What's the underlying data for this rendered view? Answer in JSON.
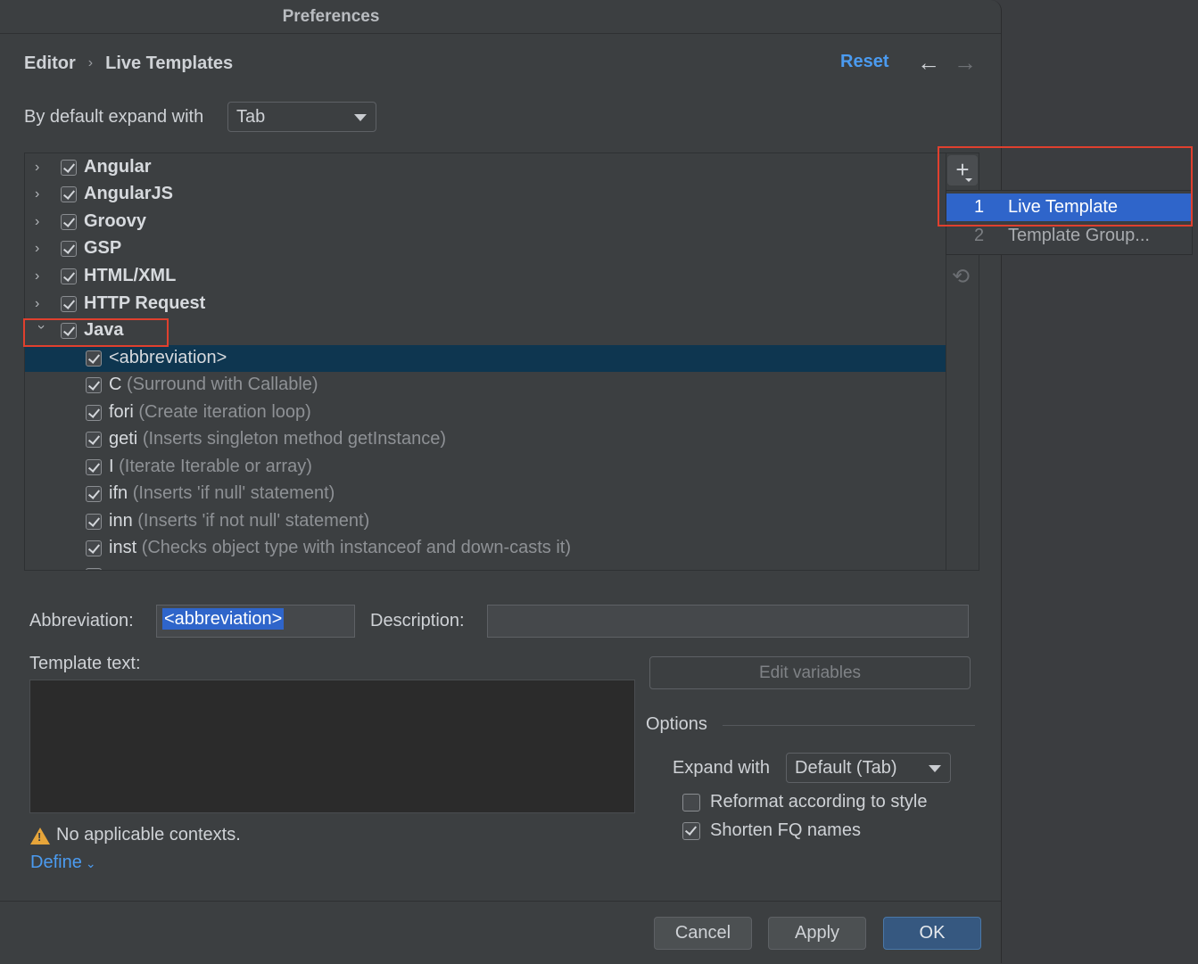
{
  "window": {
    "title": "Preferences"
  },
  "breadcrumb": {
    "parent": "Editor",
    "separator": "›",
    "current": "Live Templates"
  },
  "header": {
    "reset_label": "Reset",
    "back_icon": "←",
    "forward_icon": "→"
  },
  "expand_with": {
    "label": "By default expand with",
    "value": "Tab"
  },
  "tree": {
    "groups": [
      {
        "name": "Angular",
        "checked": true,
        "expanded": false
      },
      {
        "name": "AngularJS",
        "checked": true,
        "expanded": false
      },
      {
        "name": "Groovy",
        "checked": true,
        "expanded": false
      },
      {
        "name": "GSP",
        "checked": true,
        "expanded": false
      },
      {
        "name": "HTML/XML",
        "checked": true,
        "expanded": false
      },
      {
        "name": "HTTP Request",
        "checked": true,
        "expanded": false
      },
      {
        "name": "Java",
        "checked": true,
        "expanded": true
      }
    ],
    "java_items": [
      {
        "abbr": "<abbreviation>",
        "desc": "",
        "selected": true
      },
      {
        "abbr": "C",
        "desc": "(Surround with Callable)"
      },
      {
        "abbr": "fori",
        "desc": "(Create iteration loop)"
      },
      {
        "abbr": "geti",
        "desc": "(Inserts singleton method getInstance)"
      },
      {
        "abbr": "I",
        "desc": "(Iterate Iterable or array)"
      },
      {
        "abbr": "ifn",
        "desc": "(Inserts 'if null' statement)"
      },
      {
        "abbr": "inn",
        "desc": "(Inserts 'if not null' statement)"
      },
      {
        "abbr": "inst",
        "desc": "(Checks object type with instanceof and down-casts it)"
      }
    ]
  },
  "toolbar": {
    "add_icon": "+",
    "undo_icon": "⟲"
  },
  "popup": {
    "items": [
      {
        "num": "1",
        "label": "Live Template"
      },
      {
        "num": "2",
        "label": "Template Group..."
      }
    ]
  },
  "editor": {
    "abbreviation_label": "Abbreviation:",
    "abbreviation_value": "<abbreviation>",
    "description_label": "Description:",
    "description_value": "",
    "template_text_label": "Template text:",
    "template_text_value": "",
    "edit_variables_label": "Edit variables",
    "warning_text": "No applicable contexts.",
    "define_label": "Define"
  },
  "options": {
    "title": "Options",
    "expand_with_label": "Expand with",
    "expand_with_value": "Default (Tab)",
    "reformat_label": "Reformat according to style",
    "reformat_checked": false,
    "shorten_label": "Shorten FQ names",
    "shorten_checked": true
  },
  "footer": {
    "cancel_label": "Cancel",
    "apply_label": "Apply",
    "ok_label": "OK"
  },
  "colors": {
    "accent": "#4b9bf0",
    "selection": "#2f65ca",
    "highlight_box": "#e0402e",
    "row_selected": "#0e3650"
  }
}
